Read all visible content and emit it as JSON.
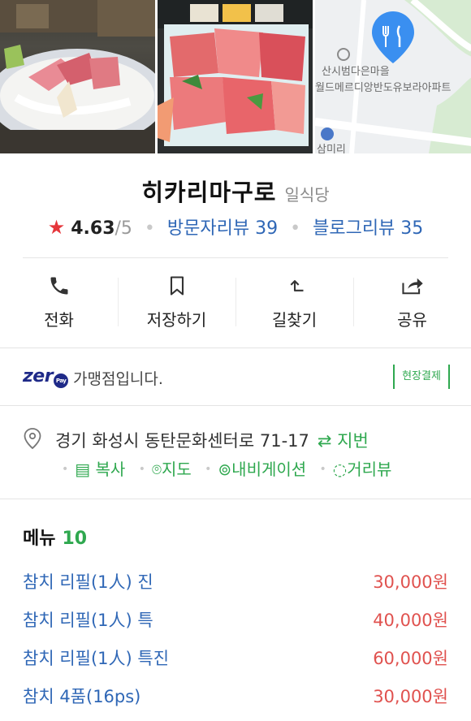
{
  "place": {
    "name": "히카리마구로",
    "category": "일식당",
    "rating": "4.63",
    "rating_max": "/5",
    "visitor_reviews": "방문자리뷰 39",
    "blog_reviews": "블로그리뷰 35"
  },
  "actions": [
    {
      "label": "전화",
      "icon": "phone-icon"
    },
    {
      "label": "저장하기",
      "icon": "bookmark-icon"
    },
    {
      "label": "길찾기",
      "icon": "directions-icon"
    },
    {
      "label": "공유",
      "icon": "share-icon"
    }
  ],
  "zeropay": {
    "logo": "zer",
    "logo_o": "Pay",
    "text": "가맹점입니다.",
    "onsite": "현장결제"
  },
  "address": {
    "text": "경기 화성시 동탄문화센터로 71-17",
    "jibeon": "⇄ 지번",
    "links": [
      "복사",
      "지도",
      "내비게이션",
      "거리뷰"
    ]
  },
  "map": {
    "labels": [
      "산시범다은마을",
      "월드메르디앙반도유보라아파트",
      "삼미리"
    ]
  },
  "menu": {
    "title": "메뉴",
    "count": "10",
    "items": [
      {
        "name": "참치 리필(1人) 진",
        "price": "30,000원"
      },
      {
        "name": "참치 리필(1人) 특",
        "price": "40,000원"
      },
      {
        "name": "참치 리필(1人) 특진",
        "price": "60,000원"
      },
      {
        "name": "참치 4품(16ps)",
        "price": "30,000원"
      }
    ]
  },
  "colors": {
    "accent_green": "#2fa84f",
    "link_blue": "#2f67b6",
    "price_red": "#e0524f",
    "star_red": "#e5363b",
    "zero_navy": "#1f2a88"
  }
}
